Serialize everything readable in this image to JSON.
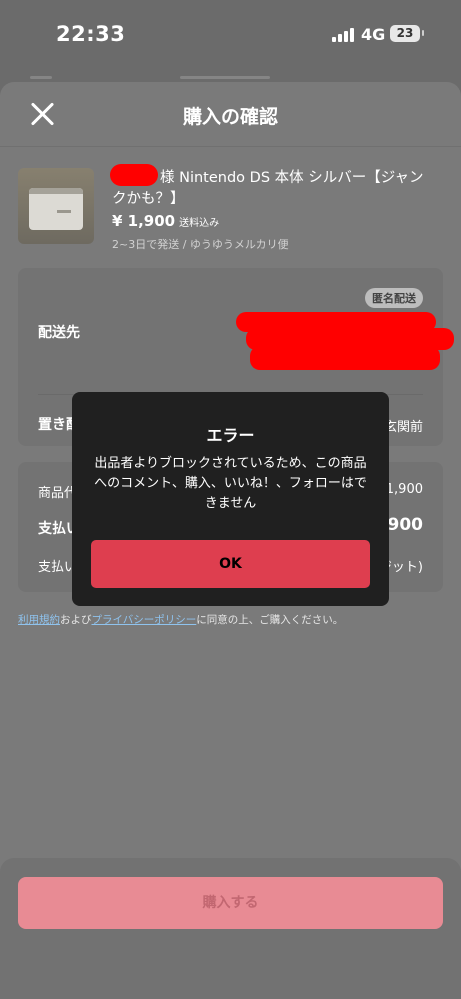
{
  "status": {
    "time": "22:33",
    "network": "4G",
    "battery": "23"
  },
  "header": {
    "title": "購入の確認"
  },
  "product": {
    "title": "様 Nintendo DS 本体 シルバー【ジャンクかも？】",
    "price": "¥ 1,900",
    "price_note": "送料込み",
    "shipping": "2~3日で発送 / ゆうゆうメルカリ便"
  },
  "shipping_card": {
    "badge": "匿名配送",
    "destination_label": "配送先",
    "placement_label": "置き配",
    "placement_value": "玄関前"
  },
  "payment_card": {
    "item_price_label": "商品代金",
    "item_price_value": "¥ 1,900",
    "total_label": "支払い金額",
    "total_value": "¥ 1,900",
    "method_label": "支払い方法",
    "method_value": "(ポイント・クレジット)"
  },
  "terms": {
    "link1": "利用規約",
    "text1": "および",
    "link2": "プライバシーポリシー",
    "text2": "に同意の上、ご購入ください。"
  },
  "buy_button": {
    "label": "購入する"
  },
  "alert": {
    "title": "エラー",
    "message": "出品者よりブロックされているため、この商品へのコメント、購入、いいね！、フォローはできません",
    "ok_label": "OK"
  },
  "colors": {
    "overlay": "#6b6b6b",
    "alert_bg": "#202020",
    "ok_button": "#de3e4f",
    "buy_button": "#e88b94",
    "redaction": "#ff0000",
    "link": "#8fc3ee"
  }
}
